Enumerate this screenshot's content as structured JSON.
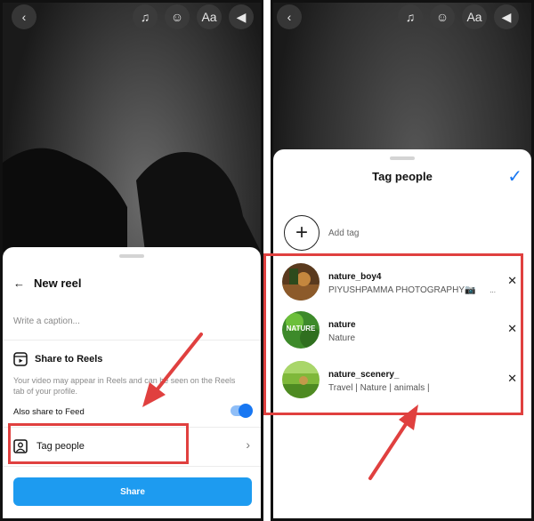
{
  "left_screen": {
    "top_icons": [
      "back-icon",
      "music-icon",
      "sticker-icon",
      "text-icon",
      "sound-icon"
    ],
    "text_icon_label": "Aa",
    "sheet": {
      "title": "New reel",
      "caption_placeholder": "Write a caption...",
      "share_to_reels_label": "Share to Reels",
      "share_to_reels_desc": "Your video may appear in Reels and can be seen on the Reels tab of your profile.",
      "also_share_label": "Also share to Feed",
      "also_share_on": true,
      "tag_people_label": "Tag people",
      "share_button_label": "Share"
    }
  },
  "right_screen": {
    "top_icons": [
      "back-icon",
      "music-icon",
      "sticker-icon",
      "text-icon",
      "sound-icon"
    ],
    "text_icon_label": "Aa",
    "sheet": {
      "title": "Tag people",
      "add_tag_label": "Add tag",
      "users": [
        {
          "username": "nature_boy4",
          "subtitle": "PIYUSHPAMMA PHOTOGRAPHY📷",
          "truncated": "..."
        },
        {
          "username": "nature",
          "subtitle": "Nature",
          "avatar_text": "NATURE"
        },
        {
          "username": "nature_scenery_",
          "subtitle": "Travel | Nature | animals |"
        }
      ]
    }
  },
  "colors": {
    "accent_blue": "#1877f2",
    "share_button": "#1d9bf0",
    "highlight_red": "#e0403f"
  }
}
